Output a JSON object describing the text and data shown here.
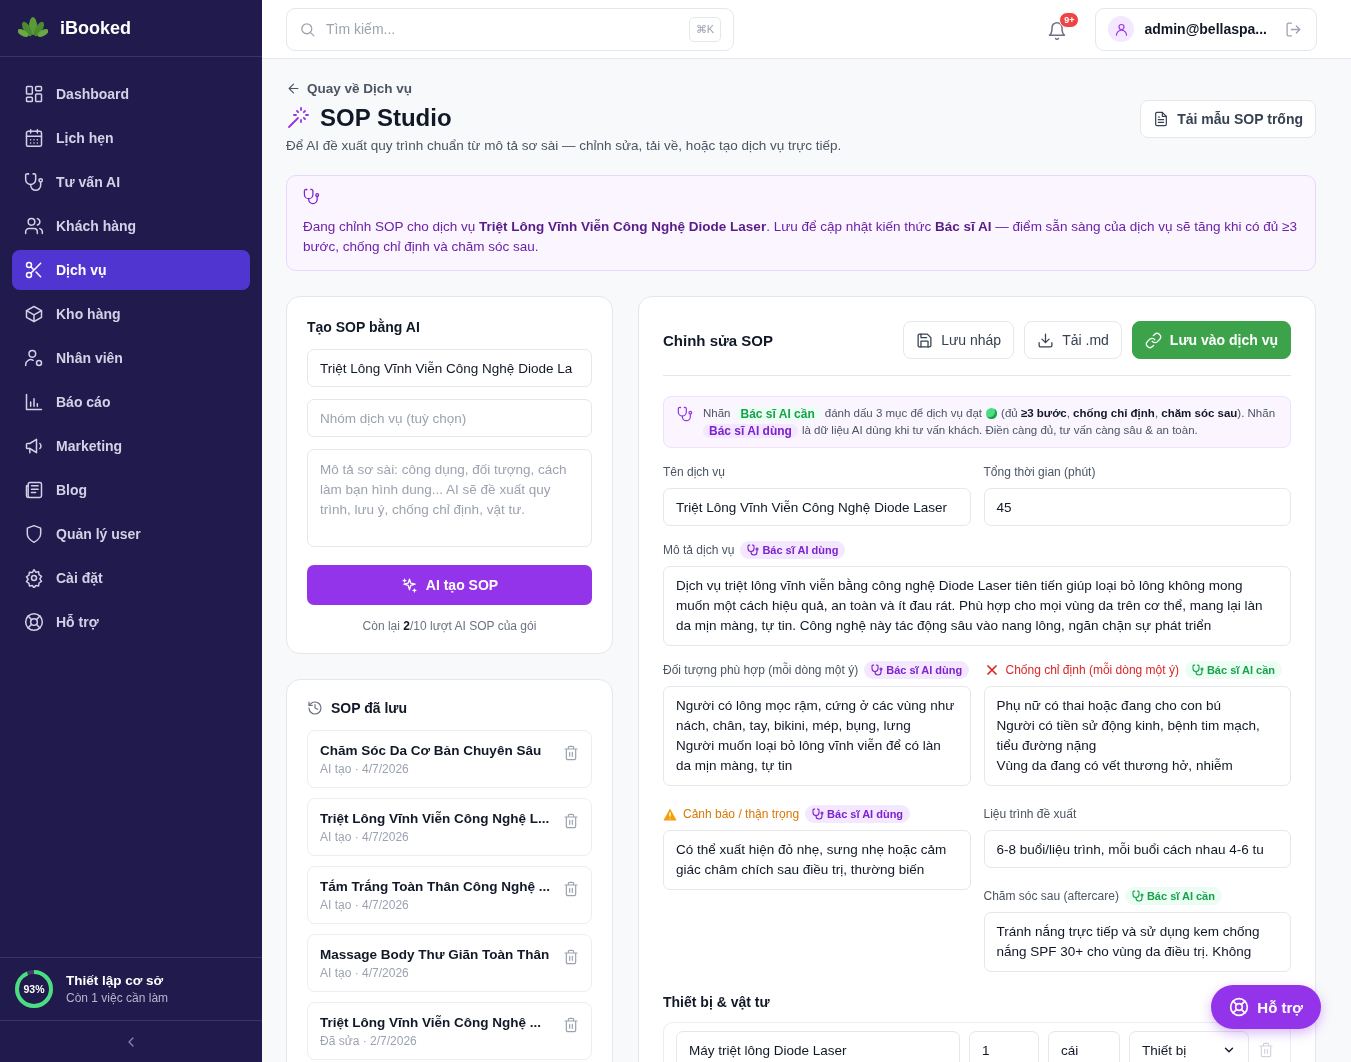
{
  "sidebar": {
    "brand": "iBooked",
    "items": [
      {
        "label": "Dashboard",
        "selected": false
      },
      {
        "label": "Lịch hẹn",
        "selected": false
      },
      {
        "label": "Tư vấn AI",
        "selected": false
      },
      {
        "label": "Khách hàng",
        "selected": false
      },
      {
        "label": "Dịch vụ",
        "selected": true
      },
      {
        "label": "Kho hàng",
        "selected": false
      },
      {
        "label": "Nhân viên",
        "selected": false
      },
      {
        "label": "Báo cáo",
        "selected": false
      },
      {
        "label": "Marketing",
        "selected": false
      },
      {
        "label": "Blog",
        "selected": false
      },
      {
        "label": "Quản lý user",
        "selected": false
      },
      {
        "label": "Cài đặt",
        "selected": false
      },
      {
        "label": "Hỗ trợ",
        "selected": false
      }
    ],
    "setup": {
      "percent": "93%",
      "level": 0.93,
      "title": "Thiết lập cơ sở",
      "subtitle": "Còn 1 việc cần làm"
    }
  },
  "topbar": {
    "search": {
      "placeholder": "Tìm kiếm...",
      "shortcut": "⌘K"
    },
    "notification_badge": "9+",
    "user": "admin@bellaspa..."
  },
  "page": {
    "back_link": "Quay về Dịch vụ",
    "title": "SOP Studio",
    "subtitle": "Để AI đề xuất quy trình chuẩn từ mô tả sơ sài — chỉnh sửa, tải về, hoặc tạo dịch vụ trực tiếp.",
    "template_button": "Tải mẫu SOP trống"
  },
  "notice": {
    "text": "Đang chỉnh SOP cho dịch vụ **Triệt Lông Vĩnh Viễn Công Nghệ Diode Laser**. Lưu để cập nhật kiến thức **Bác sĩ AI** — điểm sẵn sàng của dịch vụ sẽ tăng khi có đủ ≥3 bước, chống chỉ định và chăm sóc sau."
  },
  "ai_create": {
    "title": "Tạo SOP bằng AI",
    "name_value": "Triệt Lông Vĩnh Viễn Công Nghệ Diode La",
    "group_placeholder": "Nhóm dịch vụ (tuỳ chọn)",
    "description_placeholder": "Mô tả sơ sài: công dụng, đối tượng, cách làm bạn hình dung... AI sẽ đề xuất quy trình, lưu ý, chống chỉ định, vật tư.",
    "button": "AI tạo SOP",
    "quota": "Còn lại **2**/10 lượt AI SOP của gói"
  },
  "saved": {
    "title": "SOP đã lưu",
    "items": [
      {
        "name": "Chăm Sóc Da Cơ Bản Chuyên Sâu",
        "meta": "AI tạo · 4/7/2026"
      },
      {
        "name": "Triệt Lông Vĩnh Viễn Công Nghệ L...",
        "meta": "AI tạo · 4/7/2026"
      },
      {
        "name": "Tắm Trắng Toàn Thân Công Nghệ ...",
        "meta": "AI tạo · 4/7/2026"
      },
      {
        "name": "Massage Body Thư Giãn Toàn Thân",
        "meta": "AI tạo · 4/7/2026"
      },
      {
        "name": "Triệt Lông Vĩnh Viễn Công Nghệ ...",
        "meta": "Đã sửa · 2/7/2026"
      }
    ]
  },
  "editor": {
    "title": "Chỉnh sửa SOP",
    "buttons": [
      {
        "label": "Lưu nháp",
        "kind": "secondary"
      },
      {
        "label": "Tải .md",
        "kind": "secondary"
      },
      {
        "label": "Lưu vào dịch vụ",
        "kind": "primary"
      }
    ],
    "legend": [
      {
        "kind": "text",
        "text": "Nhãn"
      },
      {
        "kind": "tag_required",
        "text": "Bác sĩ AI cần"
      },
      {
        "kind": "text",
        "text": "đánh dấu 3 mục để dịch vụ đạt"
      },
      {
        "kind": "dot"
      },
      {
        "kind": "text",
        "text": "(đủ **≥3 bước**, **chống chỉ định**, **chăm sóc sau**). Nhãn"
      },
      {
        "kind": "tag_used",
        "text": "Bác sĩ AI dùng"
      },
      {
        "kind": "text",
        "text": "là dữ liệu AI dùng khi tư vấn khách. Điền càng đủ, tư vấn càng sâu & an toàn."
      }
    ],
    "top_fields": [
      {
        "label": {
          "kind": "plain",
          "text": "Tên dịch vụ"
        },
        "kind": "input",
        "value": "Triệt Lông Vĩnh Viễn Công Nghệ Diode Laser"
      },
      {
        "label": {
          "kind": "plain",
          "text": "Tổng thời gian (phút)"
        },
        "kind": "input",
        "value": "45"
      }
    ],
    "description": {
      "label": {
        "kind": "plain",
        "text": "Mô tả dịch vụ"
      },
      "tag": {
        "kind": "used",
        "text": "Bác sĩ AI dùng"
      },
      "kind": "textarea",
      "lines": [
        "Dịch vụ triệt lông vĩnh viễn bằng công nghệ Diode Laser tiên tiến giúp loại bỏ lông không mong muốn một cách hiệu quả, an toàn và ít đau rát. Phù hợp cho mọi vùng da trên cơ thể, mang lại làn da mịn màng, tự tin. Công nghệ này tác động sâu vào nang lông, ngăn chặn sự phát triển"
      ]
    },
    "left_fields": [
      {
        "label": {
          "kind": "plain",
          "text": "Đối tượng phù hợp (mỗi dòng một ý)"
        },
        "tag": {
          "kind": "used",
          "text": "Bác sĩ AI dùng"
        },
        "kind": "textarea",
        "lines": [
          "Người có lông mọc rậm, cứng ở các vùng như nách, chân, tay, bikini, mép, bụng, lưng",
          "Người muốn loại bỏ lông vĩnh viễn để có làn da mịn màng, tự tin"
        ]
      },
      {
        "label": {
          "kind": "warning",
          "text": "Cảnh báo / thận trọng"
        },
        "tag": {
          "kind": "used",
          "text": "Bác sĩ AI dùng"
        },
        "kind": "textarea",
        "lines": [
          "Có thể xuất hiện đỏ nhẹ, sưng nhẹ hoặc cảm giác châm chích sau điều trị, thường biến"
        ]
      }
    ],
    "right_fields": [
      {
        "label": {
          "kind": "danger",
          "text": "Chống chỉ định (mỗi dòng một ý)"
        },
        "tag": {
          "kind": "required",
          "text": "Bác sĩ AI cần"
        },
        "kind": "textarea",
        "lines": [
          "Phụ nữ có thai hoặc đang cho con bú",
          "Người có tiền sử động kinh, bệnh tim mạch, tiểu đường nặng",
          "Vùng da đang có vết thương hở, nhiễm"
        ]
      },
      {
        "label": {
          "kind": "plain",
          "text": "Liệu trình đề xuất"
        },
        "kind": "input",
        "value": "6-8 buổi/liệu trình, mỗi buổi cách nhau 4-6 tu"
      },
      {
        "label": {
          "kind": "plain",
          "text": "Chăm sóc sau (aftercare)"
        },
        "tag": {
          "kind": "required",
          "text": "Bác sĩ AI cần"
        },
        "kind": "textarea",
        "lines": [
          "Tránh nắng trực tiếp và sử dụng kem chống nắng SPF 30+ cho vùng da điều trị. Không"
        ]
      }
    ],
    "equipment": {
      "title": "Thiết bị & vật tư",
      "row": [
        {
          "kind": "input",
          "value": "Máy triệt lông Diode Laser"
        },
        {
          "kind": "input",
          "value": "1"
        },
        {
          "kind": "input",
          "value": "cái"
        },
        {
          "kind": "select",
          "value": "Thiết bị"
        }
      ]
    }
  },
  "help_button": "Hỗ trợ"
}
